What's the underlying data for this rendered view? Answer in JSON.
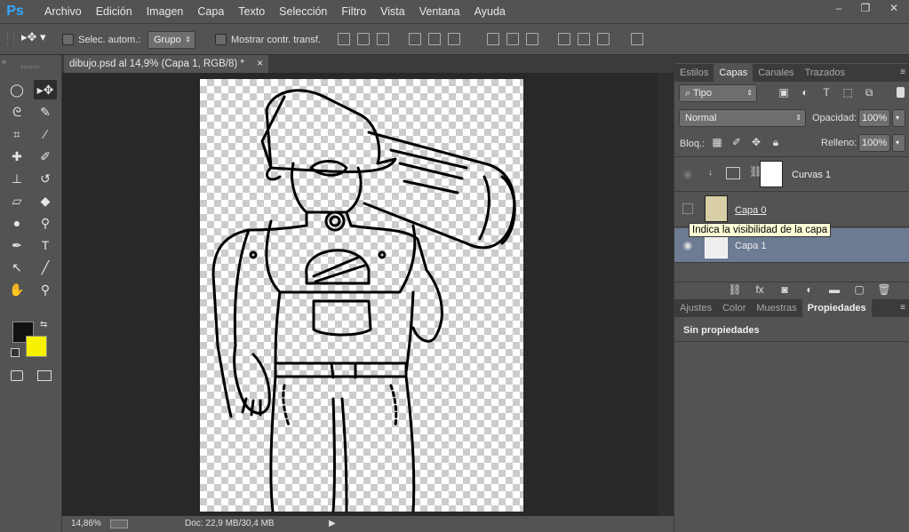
{
  "app": {
    "logo": "Ps"
  },
  "menu": [
    "Archivo",
    "Edición",
    "Imagen",
    "Capa",
    "Texto",
    "Selección",
    "Filtro",
    "Vista",
    "Ventana",
    "Ayuda"
  ],
  "window_controls": {
    "minimize": "–",
    "restore": "❐",
    "close": "✕"
  },
  "options": {
    "auto_select_label": "Selec. autom.:",
    "auto_select_value": "Grupo",
    "transform_label": "Mostrar contr. transf."
  },
  "document": {
    "tab_title": "dibujo.psd al 14,9% (Capa 1, RGB/8) *",
    "close": "×"
  },
  "status": {
    "zoom": "14,86%",
    "doc_info": "Doc: 22,9 MB/30,4 MB",
    "arrow": "▶"
  },
  "colors": {
    "foreground": "#111111",
    "background": "#f7f200",
    "accent": "#31a8ff",
    "selected_layer": "#6d7b93"
  },
  "layers_panel": {
    "tabs": [
      "Estilos",
      "Capas",
      "Canales",
      "Trazados"
    ],
    "active_tab": "Capas",
    "filter": "Tipo",
    "blend_mode": "Normal",
    "opacity_label": "Opacidad:",
    "opacity_value": "100%",
    "lock_label": "Bloq.:",
    "fill_label": "Relleno:",
    "fill_value": "100%",
    "layers": [
      {
        "name": "Curvas 1"
      },
      {
        "name": "Capa 0"
      },
      {
        "name": "Capa 1"
      }
    ],
    "tooltip": "Indica la visibilidad de la capa"
  },
  "properties_panel": {
    "tabs": [
      "Ajustes",
      "Color",
      "Muestras",
      "Propiedades"
    ],
    "active_tab": "Propiedades",
    "content": "Sin propiedades"
  }
}
